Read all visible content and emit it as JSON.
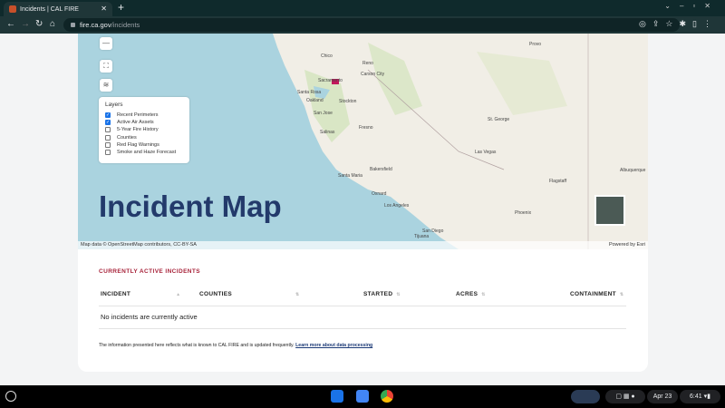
{
  "browser": {
    "tab_title": "Incidents | CAL FIRE",
    "url_host": "fire.ca.gov",
    "url_path": "/incidents"
  },
  "map": {
    "layers_title": "Layers",
    "layers": [
      {
        "label": "Recent Perimeters",
        "checked": true
      },
      {
        "label": "Active Air Assets",
        "checked": true
      },
      {
        "label": "5-Year Fire History",
        "checked": false
      },
      {
        "label": "Counties",
        "checked": false
      },
      {
        "label": "Red Flag Warnings",
        "checked": false
      },
      {
        "label": "Smoke and Haze Forecast",
        "checked": false
      }
    ],
    "heading": "Incident Map",
    "attribution": "Map data © OpenStreetMap contributors, CC-BY-SA",
    "powered_by": "Powered by Esri",
    "places": [
      "Chico",
      "Sacramento",
      "Santa Rosa",
      "Oakland",
      "San Jose",
      "Stockton",
      "Fresno",
      "Salinas",
      "Bakersfield",
      "Santa Maria",
      "Los Angeles",
      "Oxnard",
      "San Diego",
      "Tijuana",
      "Las Vegas",
      "St. George",
      "Provo",
      "Carson City",
      "Phoenix",
      "Albuquerque",
      "Flagstaff",
      "Reno"
    ]
  },
  "incidents": {
    "section_title": "CURRENTLY ACTIVE INCIDENTS",
    "columns": [
      "INCIDENT",
      "COUNTIES",
      "STARTED",
      "ACRES",
      "CONTAINMENT"
    ],
    "empty_message": "No incidents are currently active",
    "footnote": "The information presented here reflects what is known to CAL FIRE and is updated frequently.",
    "footnote_link": "Learn more about data processing"
  },
  "taskbar": {
    "date": "Apr 23",
    "time": "6:41"
  }
}
